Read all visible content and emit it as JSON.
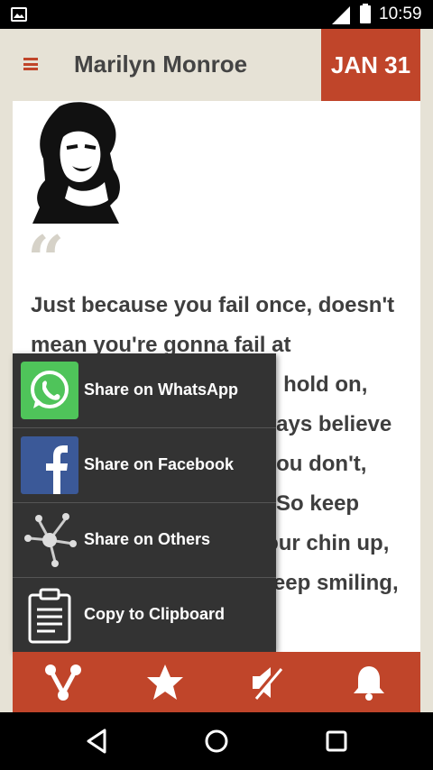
{
  "status_bar": {
    "time": "10:59"
  },
  "header": {
    "title": "Marilyn Monroe",
    "date": "JAN 31"
  },
  "quote": {
    "open_mark": "“",
    "text": "Just because you fail once, doesn't mean you're gonna fail at everything. Keep trying, hold on, and always, always, always believe in yourself, because if you don't, then who will, sweetie? So keep your head high, keep your chin up, and most importantly, keep smiling,"
  },
  "share_menu": {
    "items": [
      {
        "label": "Share on WhatsApp",
        "icon": "whatsapp-icon"
      },
      {
        "label": "Share on Facebook",
        "icon": "facebook-icon"
      },
      {
        "label": "Share on Others",
        "icon": "share-nodes-icon"
      },
      {
        "label": "Copy to Clipboard",
        "icon": "clipboard-icon"
      }
    ]
  },
  "bottom_bar": {
    "icons": [
      "share-icon",
      "star-icon",
      "mute-icon",
      "bell-icon"
    ]
  },
  "nav_bar": {
    "icons": [
      "back-icon",
      "home-icon",
      "recents-icon"
    ]
  },
  "colors": {
    "accent": "#c0452a",
    "background": "#e6e2d6",
    "menu": "#333333",
    "whatsapp": "#4fc45a",
    "facebook": "#3b5998"
  }
}
